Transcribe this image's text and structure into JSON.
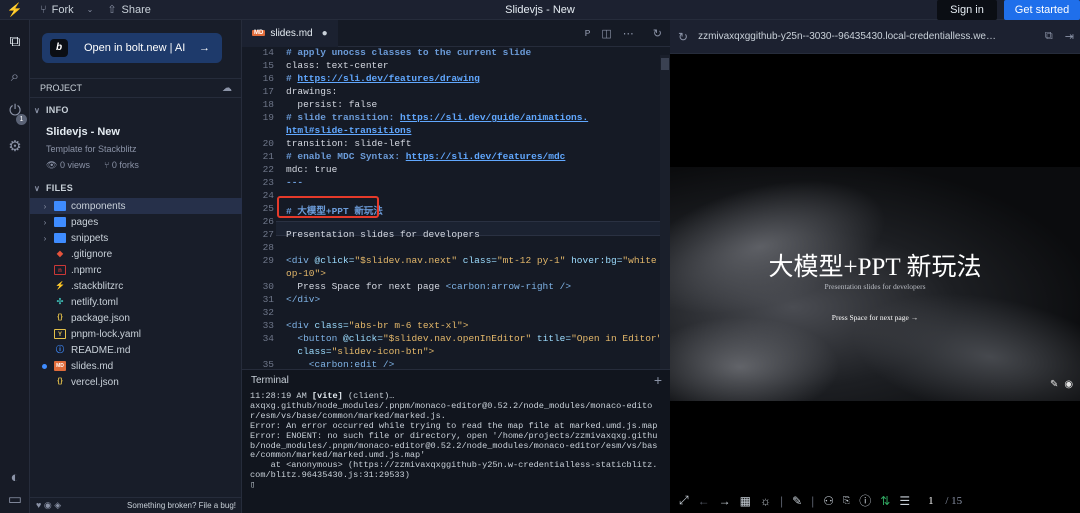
{
  "topbar": {
    "fork": "Fork",
    "share": "Share",
    "title": "Slidevjs - New",
    "signin": "Sign in",
    "get_started": "Get started"
  },
  "activity": {
    "badge": "1"
  },
  "sidebar": {
    "bolt_cta": "Open in bolt.new | AI",
    "project_label": "PROJECT",
    "info_label": "INFO",
    "info_title": "Slidevjs - New",
    "info_subtitle": "Template for Stackblitz",
    "views": "0 views",
    "forks": "0 forks",
    "files_label": "FILES",
    "files": [
      {
        "name": "components",
        "type": "folder"
      },
      {
        "name": "pages",
        "type": "folder"
      },
      {
        "name": "snippets",
        "type": "folder"
      },
      {
        "name": ".gitignore",
        "type": "git"
      },
      {
        "name": ".npmrc",
        "type": "npm"
      },
      {
        "name": ".stackblitzrc",
        "type": "bolt"
      },
      {
        "name": "netlify.toml",
        "type": "netlify"
      },
      {
        "name": "package.json",
        "type": "json"
      },
      {
        "name": "pnpm-lock.yaml",
        "type": "yaml"
      },
      {
        "name": "README.md",
        "type": "info"
      },
      {
        "name": "slides.md",
        "type": "md"
      },
      {
        "name": "vercel.json",
        "type": "json"
      }
    ],
    "footer": "Something broken? File a bug!"
  },
  "editor": {
    "tab": "slides.md",
    "line_numbers": [
      "14",
      "15",
      "16",
      "17",
      "18",
      "19",
      "",
      "20",
      "21",
      "22",
      "23",
      "24",
      "25",
      "26",
      "27",
      "28",
      "29",
      "",
      "30",
      "31",
      "32",
      "33",
      "34",
      "",
      "35"
    ],
    "lines": {
      "l14": "# apply unocss classes to the current slide",
      "l15": "class: text-center",
      "l16a": "# ",
      "l16b": "https://sli.dev/features/drawing",
      "l17": "drawings:",
      "l18": "  persist: false",
      "l19a": "# slide transition: ",
      "l19b": "https://sli.dev/guide/animations.",
      "l19c": "html#slide-transitions",
      "l20": "transition: slide-left",
      "l21a": "# enable MDC Syntax: ",
      "l21b": "https://sli.dev/features/mdc",
      "l22": "mdc: true",
      "l23": "---",
      "l25": "# 大模型+PPT 新玩法",
      "l27": "Presentation slides for developers",
      "l29a": "<div ",
      "l29b": "@click=",
      "l29c": "\"$slidev.nav.next\"",
      "l29d": " class=",
      "l29e": "\"mt-12 py-1\"",
      "l29f": " hover:bg=",
      "l29g": "\"white",
      "l29h": "op-10\">",
      "l30a": "  Press Space for next page ",
      "l30b": "<carbon:arrow-right />",
      "l31": "</div>",
      "l33a": "<div ",
      "l33b": "class=",
      "l33c": "\"abs-br m-6 text-xl\">",
      "l34a": "  <button ",
      "l34b": "@click=",
      "l34c": "\"$slidev.nav.openInEditor\"",
      "l34d": " title=",
      "l34e": "\"Open in Editor\"",
      "l34f": "  class=",
      "l34g": "\"slidev-icon-btn\">",
      "l35": "    <carbon:edit />"
    }
  },
  "terminal": {
    "title": "Terminal",
    "time": "11:28:19 AM ",
    "vite": "[vite]",
    "client": " (client)…",
    "body": "axqxg.github/node_modules/.pnpm/monaco-editor@0.52.2/node_modules/monaco-editor/esm/vs/base/common/marked/marked.js.\nError: An error occurred while trying to read the map file at marked.umd.js.map\nError: ENOENT: no such file or directory, open '/home/projects/zzmivaxqxg.github/node_modules/.pnpm/monaco-editor@0.52.2/node_modules/monaco-editor/esm/vs/base/common/marked/marked.umd.js.map'\n    at <anonymous> (https://zzmivaxqxggithub-y25n.w-credentialless-staticblitz.com/blitz.96435430.js:31:29533)\n▯"
  },
  "preview": {
    "url": "zzmivaxqxggithub-y25n--3030--96435430.local-credentialless.we…",
    "slide_title": "大模型+PPT 新玩法",
    "slide_subtitle": "Presentation slides for developers",
    "slide_next": "Press Space for next page →",
    "page": "1",
    "page_total": "/ 15"
  }
}
